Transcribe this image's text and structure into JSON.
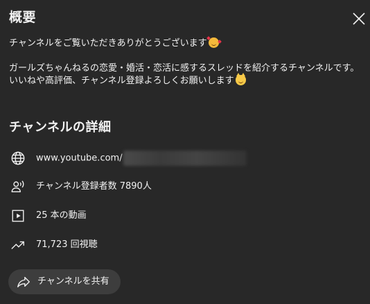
{
  "panel": {
    "title": "概要",
    "close_icon": "close-icon"
  },
  "description": {
    "line1": "チャンネルをご覧いただきありがとうございます",
    "line1_emoji": "smiling-face-with-hearts",
    "line2": "ガールズちゃんねるの恋愛・婚活・恋活に感するスレッドを紹介するチャンネルです。",
    "line3": "いいねや高評価、チャンネル登録よろしくお願いします",
    "line3_emoji": "grinning-cat"
  },
  "details": {
    "title": "チャンネルの詳細",
    "url": "www.youtube.com/",
    "subscribers": "チャンネル登録者数 7890人",
    "videos": "25 本の動画",
    "views": "71,723 回視聴"
  },
  "share": {
    "label": "チャンネルを共有"
  },
  "colors": {
    "background": "#282828",
    "text": "#f1f1f1",
    "share_button": "#3d3d3d"
  }
}
